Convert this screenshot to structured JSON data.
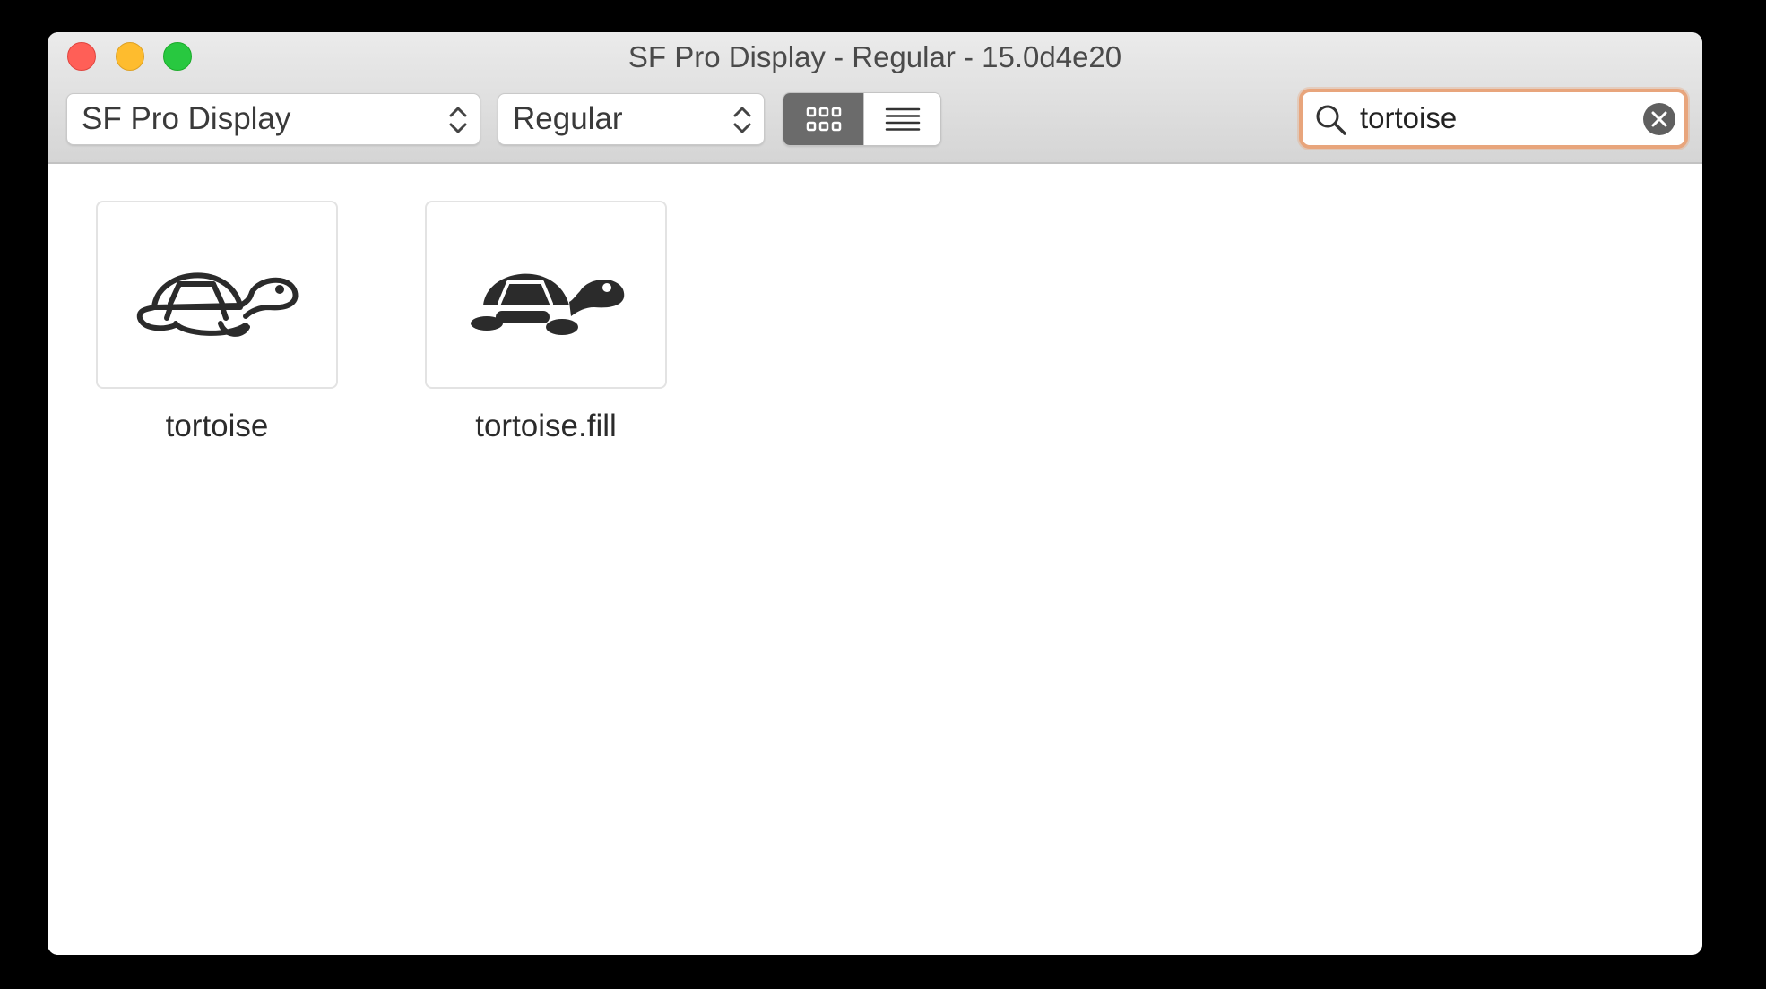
{
  "window": {
    "title": "SF Pro Display - Regular - 15.0d4e20",
    "controls": [
      "close",
      "minimize",
      "zoom"
    ]
  },
  "toolbar": {
    "font_family": "SF Pro Display",
    "font_style": "Regular",
    "view_modes": [
      {
        "name": "grid-view",
        "selected": true
      },
      {
        "name": "list-view",
        "selected": false
      }
    ]
  },
  "search": {
    "value": "tortoise",
    "icon": "magnifying-glass-icon",
    "clear_icon": "clear-x-icon",
    "focus_ring_color": "#e8a57c"
  },
  "results": [
    {
      "label": "tortoise",
      "icon": "tortoise-outline-icon"
    },
    {
      "label": "tortoise.fill",
      "icon": "tortoise-fill-icon"
    }
  ],
  "colors": {
    "selected_segment": "#6b6b6b",
    "close": "#ff5f57",
    "minimize": "#febc2e",
    "zoom": "#28c840"
  }
}
